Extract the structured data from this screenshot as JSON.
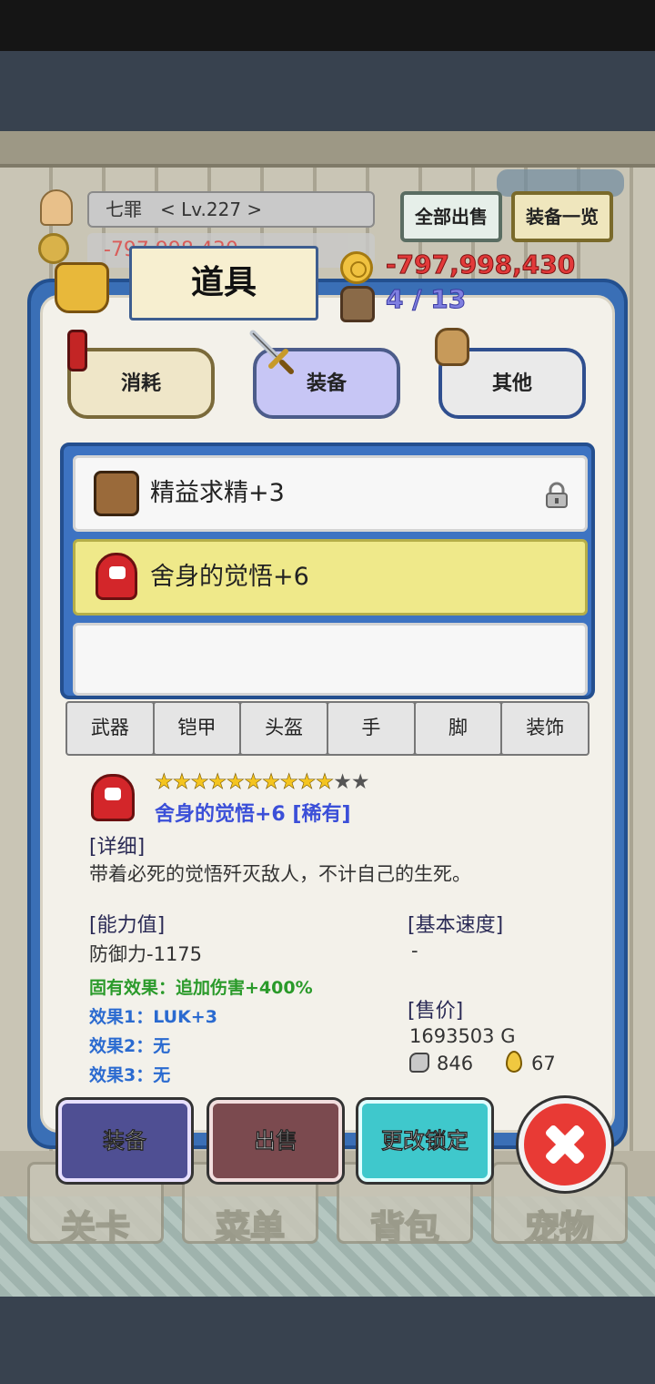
{
  "hud": {
    "player_name": "七罪",
    "level": "< Lv.227 >",
    "money_bg": "-797,998,430",
    "sell_all": "全部出售",
    "equip_list": "装备一览"
  },
  "panel": {
    "title": "道具",
    "money": "-797,998,430",
    "capacity": "4 / 13"
  },
  "categories": {
    "consume": "消耗",
    "equip": "装备",
    "other": "其他"
  },
  "items": [
    {
      "name": "精益求精+3",
      "locked": true
    },
    {
      "name": "舍身的觉悟+6",
      "selected": true
    },
    {
      "name": ""
    }
  ],
  "filters": [
    "武器",
    "铠甲",
    "头盔",
    "手",
    "脚",
    "装饰"
  ],
  "detail": {
    "stars_filled": 10,
    "stars_total": 12,
    "name": "舍身的觉悟+6 [稀有]",
    "detail_header": "[详细]",
    "description": "带着必死的觉悟歼灭敌人，不计自己的生死。",
    "ability_header": "[能力值]",
    "ability_value": "防御力-1175",
    "inherent_effect": "固有效果：追加伤害+400%",
    "effect1": "效果1：LUK+3",
    "effect2": "效果2：无",
    "effect3": "效果3：无",
    "speed_header": "[基本速度]",
    "speed_value": "-",
    "price_header": "[售价]",
    "price_value": "1693503 G",
    "ore_count": "846",
    "drop_count": "67"
  },
  "actions": {
    "equip": "装备",
    "sell": "出售",
    "change_lock": "更改锁定"
  },
  "bottom_nav": [
    "关卡",
    "菜单",
    "背包",
    "宠物"
  ],
  "colors": {
    "panel_blue": "#3a6fb6",
    "money_red": "#e23a3a",
    "rare_blue": "#3b4fd8",
    "selected_row": "#efe98a",
    "effect_green": "#2a9a2a",
    "effect_blue": "#2a6ad0"
  }
}
